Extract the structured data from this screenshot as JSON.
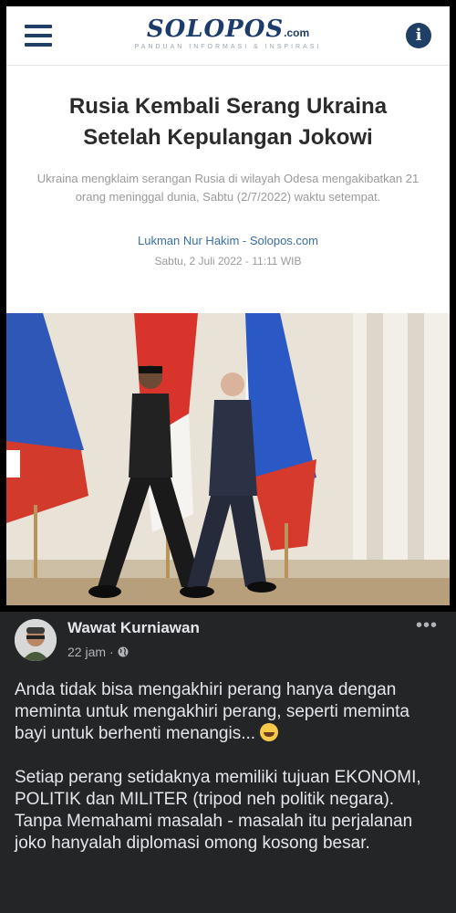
{
  "article": {
    "logo": "SOLOPOS",
    "logo_suffix": ".com",
    "tagline": "PANDUAN INFORMASI & INSPIRASI",
    "headline": "Rusia Kembali Serang Ukraina Setelah Kepulangan Jokowi",
    "summary": "Ukraina mengklaim serangan Rusia di wilayah Odesa mengakibatkan 21 orang meninggal dunia, Sabtu (2/7/2022) waktu setempat.",
    "byline": "Lukman Nur Hakim - Solopos.com",
    "date": "Sabtu, 2 Juli 2022 - 11:11 WIB",
    "menu_icon": "hamburger-menu-icon",
    "info_icon": "info-icon",
    "brand_color": "#1d3c6b"
  },
  "post": {
    "author": "Wawat Kurniawan",
    "time": "22 jam",
    "privacy_icon": "globe-icon",
    "more_icon": "more-options-icon",
    "paragraph1": "Anda tidak bisa mengakhiri perang hanya dengan meminta untuk mengakhiri perang, seperti meminta bayi untuk berhenti menangis...",
    "paragraph1_emoji": "laughing-emoji",
    "paragraph2": "Setiap perang setidaknya memiliki tujuan EKONOMI, POLITIK dan MILITER (tripod neh politik negara).  Tanpa Memahami masalah - masalah itu perjalanan joko hanyalah diplomasi omong kosong besar."
  }
}
